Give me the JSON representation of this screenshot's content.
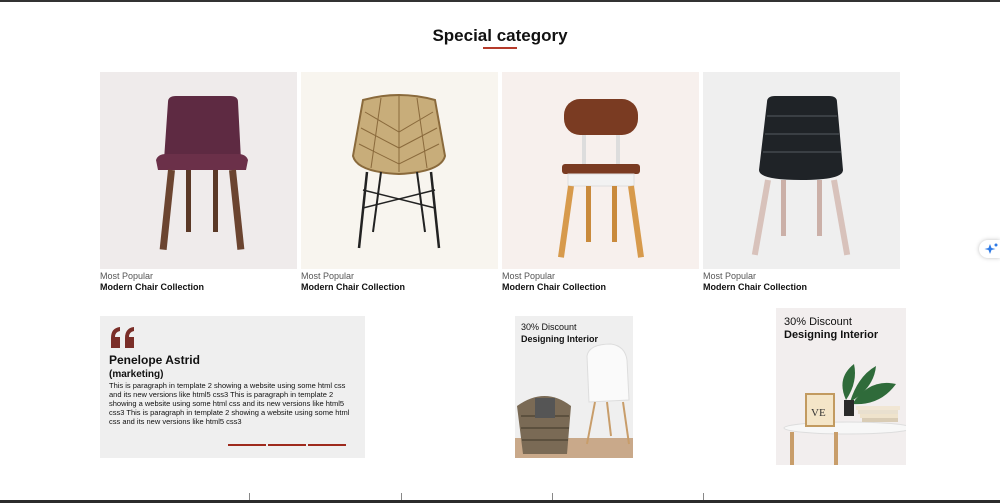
{
  "section": {
    "title": "Special category"
  },
  "products": [
    {
      "category": "Most Popular",
      "name": "Modern Chair Collection",
      "image": "purple-upholstered-chair"
    },
    {
      "category": "Most Popular",
      "name": "Modern Chair Collection",
      "image": "rattan-wire-chair"
    },
    {
      "category": "Most Popular",
      "name": "Modern Chair Collection",
      "image": "brown-wood-chair"
    },
    {
      "category": "Most Popular",
      "name": "Modern Chair Collection",
      "image": "black-leather-chair"
    }
  ],
  "testimonial": {
    "name": "Penelope Astrid",
    "role": "(marketing)",
    "text": "This is paragraph in template 2 showing a website using some html css and its new versions like html5 css3 This is paragraph in template 2 showing a website using some html css and its new versions like html5 css3 This is paragraph in template 2 showing a website using some html css and its new versions like html5 css3"
  },
  "promos": [
    {
      "discount": "30% Discount",
      "heading": "Designing Interior"
    },
    {
      "discount": "30% Discount",
      "heading": "Designing Interior"
    }
  ],
  "colors": {
    "accent": "#b53a2a",
    "quote": "#7a2e28"
  }
}
